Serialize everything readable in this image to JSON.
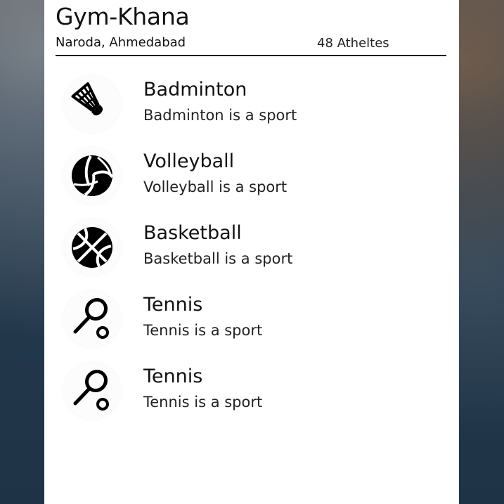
{
  "header": {
    "title": "Gym-Khana",
    "location": "Naroda, Ahmedabad",
    "athletes": "48 Atheltes"
  },
  "sports": [
    {
      "name": "Badminton",
      "description": "Badminton is a sport",
      "icon": "shuttlecock-icon"
    },
    {
      "name": "Volleyball",
      "description": "Volleyball is a sport",
      "icon": "volleyball-icon"
    },
    {
      "name": "Basketball",
      "description": "Basketball is a sport",
      "icon": "basketball-icon"
    },
    {
      "name": "Tennis",
      "description": "Tennis is a sport",
      "icon": "tennis-racket-icon"
    },
    {
      "name": "Tennis",
      "description": "Tennis is a sport",
      "icon": "tennis-racket-icon"
    }
  ]
}
